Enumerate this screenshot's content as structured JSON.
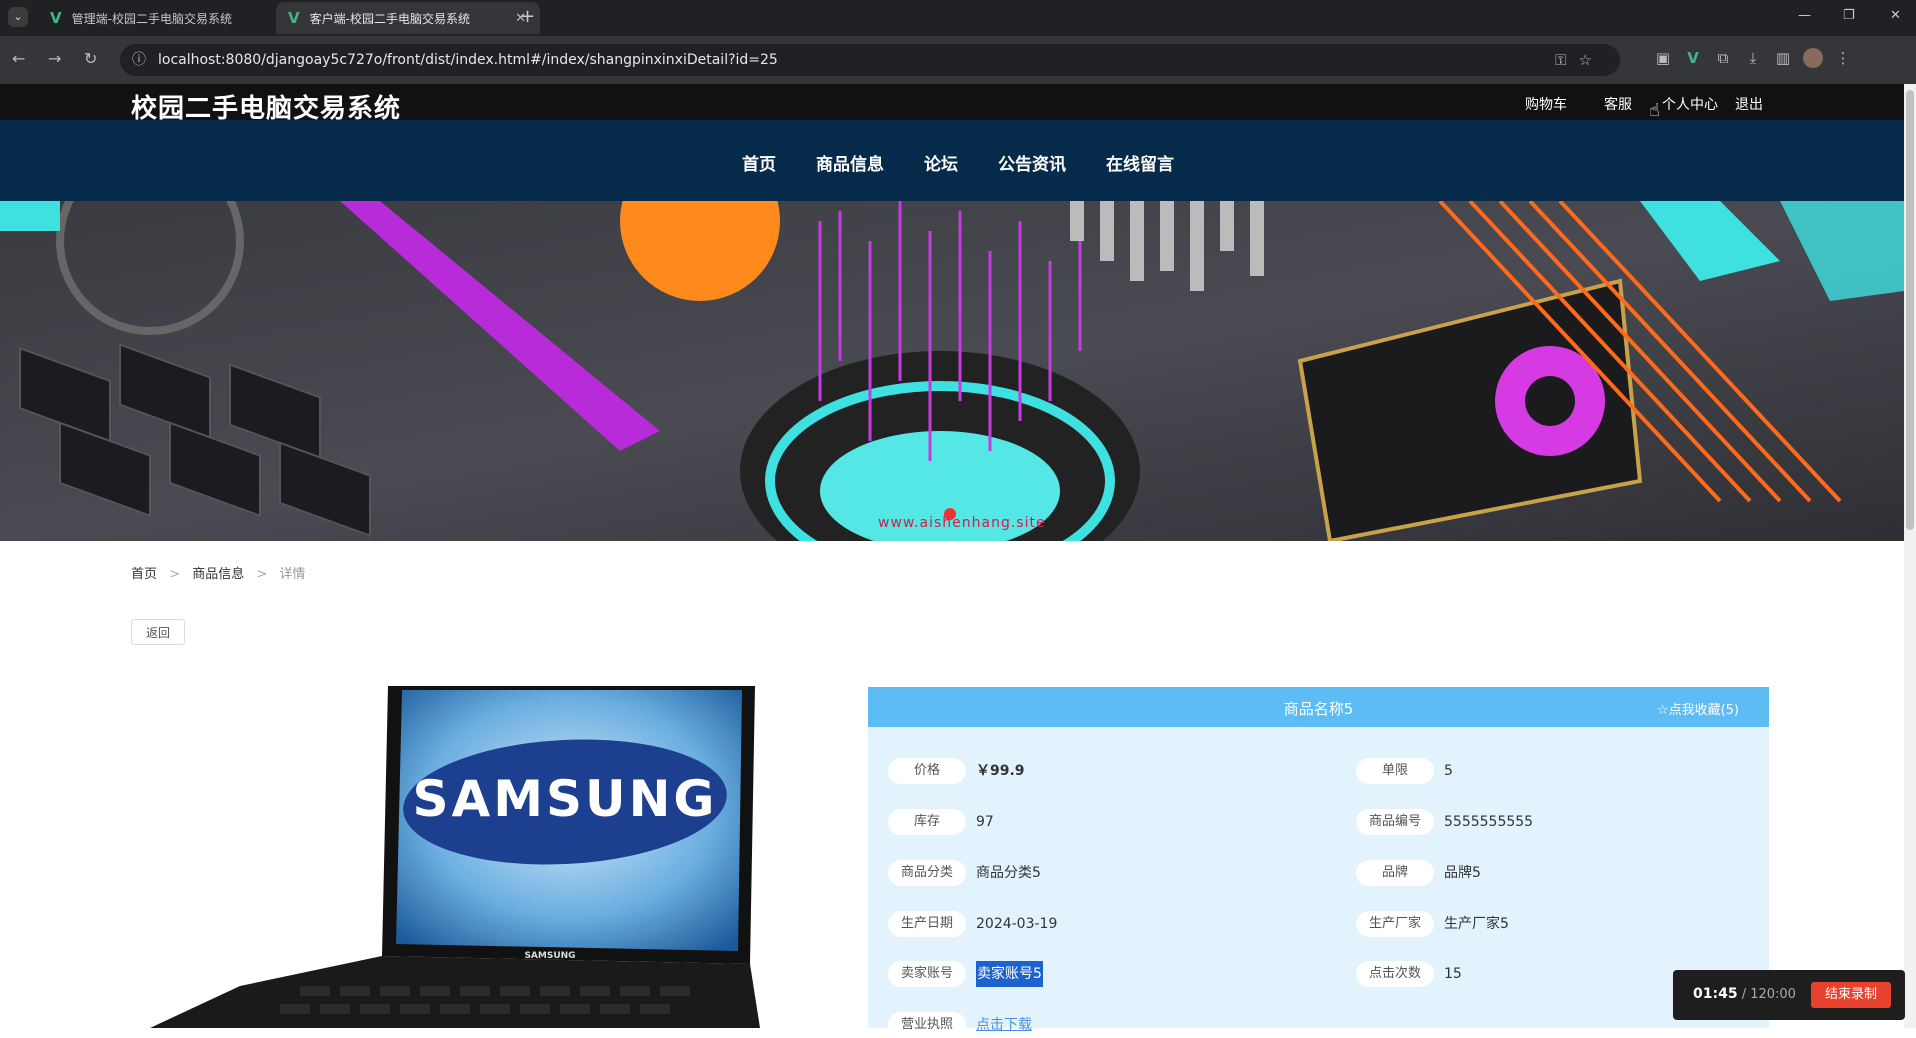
{
  "browser": {
    "tabs": [
      {
        "title": "管理端-校园二手电脑交易系统",
        "active": false
      },
      {
        "title": "客户端-校园二手电脑交易系统",
        "active": true
      }
    ],
    "url": "localhost:8080/djangoay5c727o/front/dist/index.html#/index/shangpinxinxiDetail?id=25"
  },
  "site": {
    "title": "校园二手电脑交易系统",
    "top_links": [
      "购物车",
      "客服",
      "个人中心",
      "退出"
    ],
    "nav": [
      "首页",
      "商品信息",
      "论坛",
      "公告资讯",
      "在线留言"
    ]
  },
  "banner": {
    "watermark_url": "www.aishenhang.site"
  },
  "breadcrumb": {
    "items": [
      "首页",
      "商品信息"
    ],
    "current": "详情",
    "separator": ">"
  },
  "back_button": "返回",
  "product": {
    "name": "商品名称5",
    "favorite": "☆点我收藏(5)",
    "image_brand_text": "SAMSUNG",
    "fields_left": [
      {
        "label": "价格",
        "value": "￥99.9"
      },
      {
        "label": "库存",
        "value": "97"
      },
      {
        "label": "商品分类",
        "value": "商品分类5"
      },
      {
        "label": "生产日期",
        "value": "2024-03-19"
      },
      {
        "label": "卖家账号",
        "value": "卖家账号5"
      },
      {
        "label": "营业执照",
        "value": "点击下载"
      }
    ],
    "fields_right": [
      {
        "label": "单限",
        "value": "5"
      },
      {
        "label": "商品编号",
        "value": "5555555555"
      },
      {
        "label": "品牌",
        "value": "品牌5"
      },
      {
        "label": "生产厂家",
        "value": "生产厂家5"
      },
      {
        "label": "点击次数",
        "value": "15"
      }
    ]
  },
  "recorder": {
    "elapsed": "01:45",
    "total": " / 120:00",
    "stop_label": "结束录制"
  },
  "colors": {
    "nav_bg": "#062a4a",
    "panel_header": "#5dbcf3",
    "panel_bg": "#e3f3fd",
    "record_button": "#e8412d"
  }
}
